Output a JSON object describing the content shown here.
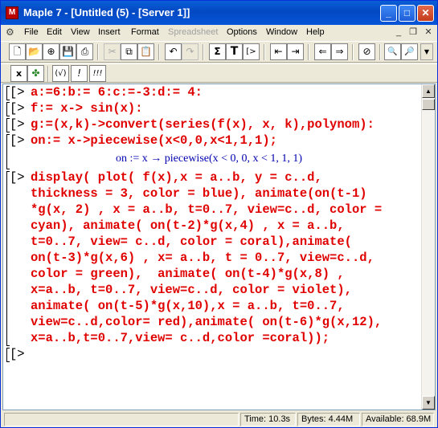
{
  "window": {
    "title": "Maple 7  - [Untitled (5) - [Server 1]]",
    "minimize": "_",
    "maximize": "□",
    "close": "✕"
  },
  "menu": {
    "items": [
      "File",
      "Edit",
      "View",
      "Insert",
      "Format",
      "Spreadsheet",
      "Options",
      "Window",
      "Help"
    ],
    "disabled": [
      "Spreadsheet"
    ]
  },
  "toolbar": {
    "sum_symbol": "Σ",
    "text_symbol": "T",
    "prompt_symbol": "[>",
    "context_x": "x",
    "context_parens": "(√)",
    "context_bang": "!",
    "context_bangs": "!!!"
  },
  "worksheet": {
    "lines": [
      {
        "prompt": "[>",
        "text": "a:=6:b:= 6:c:=-3:d:= 4:"
      },
      {
        "prompt": "[>",
        "text": "f:= x-> sin(x):"
      },
      {
        "prompt": "[>",
        "text": "g:=(x,k)->convert(series(f(x), x, k),polynom):"
      },
      {
        "prompt": "[>",
        "text": "on:= x->piecewise(x<0,0,x<1,1,1);"
      }
    ],
    "output": "on := x → piecewise(x < 0, 0, x < 1, 1, 1)",
    "display_prompt": "[>",
    "display_lines": [
      "display( plot( f(x),x = a..b, y = c..d,",
      "thickness = 3, color = blue), animate(on(t-1)",
      "*g(x, 2) , x = a..b, t=0..7, view=c..d, color =",
      "cyan), animate( on(t-2)*g(x,4) , x = a..b,",
      "t=0..7, view= c..d, color = coral),animate(",
      "on(t-3)*g(x,6) , x= a..b, t = 0..7, view=c..d,",
      "color = green),  animate( on(t-4)*g(x,8) ,",
      "x=a..b, t=0..7, view=c..d, color = violet),",
      "animate( on(t-5)*g(x,10),x = a..b, t=0..7,",
      "view=c..d,color= red),animate( on(t-6)*g(x,12),",
      "x=a..b,t=0..7,view= c..d,color =coral));"
    ],
    "empty_prompt": "[>"
  },
  "status": {
    "time": "Time: 10.3s",
    "bytes": "Bytes: 4.44M",
    "available": "Available: 68.9M"
  }
}
